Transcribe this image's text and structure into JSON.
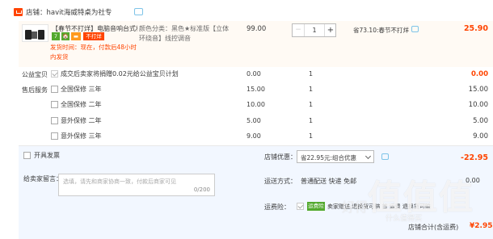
{
  "store": {
    "label": "店铺：havit海威特桌为社专",
    "icon": "store-icon",
    "chat_icon": "chat-icon"
  },
  "item": {
    "title": "【春节不打烊】电脑音响台式机...",
    "badges": [
      "7",
      "🏠",
      "▬",
      "不打烊"
    ],
    "ship_note": "发货时间：现在，付款后48小时",
    "gift_note": "内发货",
    "attributes": "颜色分类：黑色★标准版【立体环绕音】线控调音",
    "price": "99.00",
    "quantity": "1",
    "minus": "−",
    "plus": "+",
    "promo": "省73.10:春节不打烊",
    "subtotal": "25.90"
  },
  "charity": {
    "label": "公益宝贝",
    "option": "成交后卖家将捐赠0.02元给公益宝贝计划",
    "price": "0.00",
    "qty": "1",
    "subtotal": "0.00"
  },
  "after_sales": {
    "label": "售后服务",
    "options": [
      {
        "text": "全国保修  三年",
        "price": "15.00",
        "qty": "1",
        "subtotal": "15.00"
      },
      {
        "text": "全国保修  二年",
        "price": "10.00",
        "qty": "1",
        "subtotal": "10.00"
      },
      {
        "text": "意外保修  二年",
        "price": "5.00",
        "qty": "1",
        "subtotal": "5.00"
      },
      {
        "text": "意外保修  三年",
        "price": "9.00",
        "qty": "1",
        "subtotal": "9.00"
      }
    ]
  },
  "invoice": {
    "label": "开具发票"
  },
  "message": {
    "label": "给卖家留言：",
    "placeholder": "选填，请先和商家协商一致，付款后商家可见",
    "count": "0/200"
  },
  "discount": {
    "label": "店铺优惠：",
    "selected": "省22.95元:组合优惠",
    "amount": "-22.95"
  },
  "shipping": {
    "label": "运送方式：",
    "value": "普通配送 快递 免邮",
    "fee": "0.00"
  },
  "insurance": {
    "label": "运费险：",
    "badge": "运费险",
    "text": "卖家赠送,退换货可赔 首 运费 退换货可赔"
  },
  "total": {
    "label": "店铺合计(含运费)",
    "amount": "¥2.95"
  },
  "watermark": {
    "main": "值值值",
    "sub": "什么值得买",
    "tag": "好得"
  },
  "colors": {
    "accent": "#ff4400",
    "badge_green": "#53a92e",
    "badge_orange": "#ff9b20",
    "bottom_bg": "#f2f7ff",
    "item_bg": "#fffaf4"
  }
}
